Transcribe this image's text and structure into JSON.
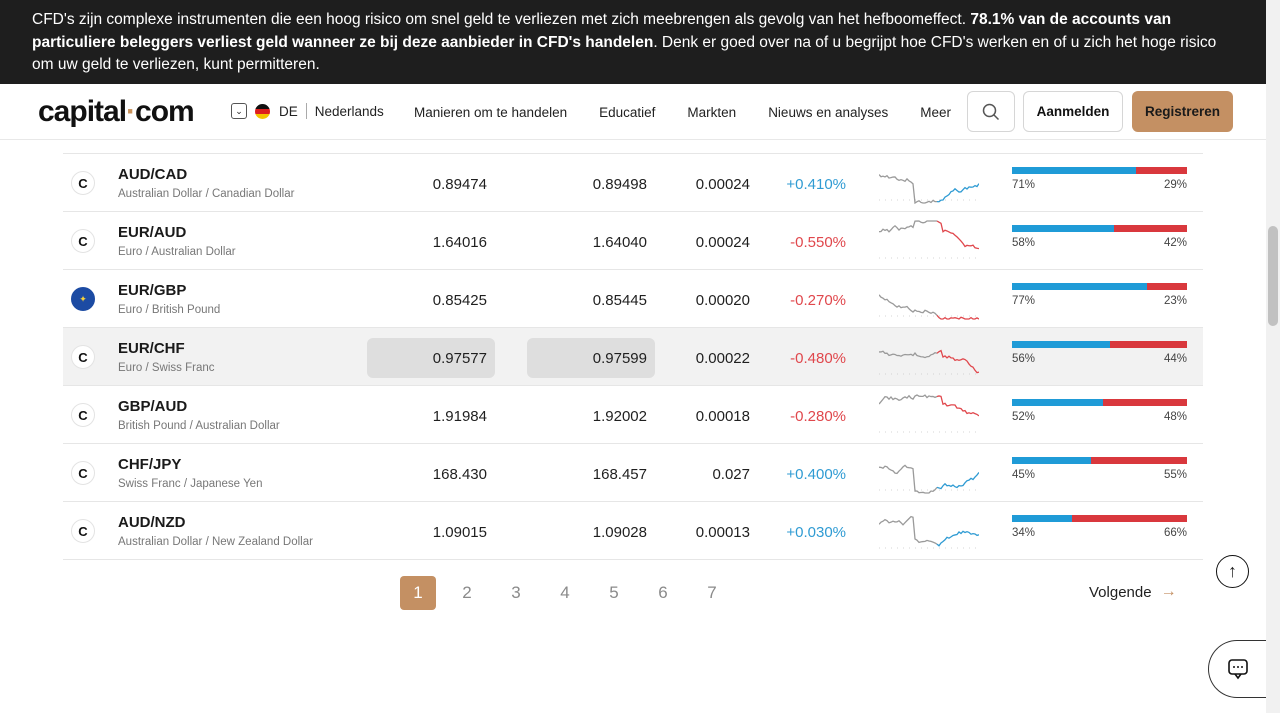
{
  "risk_banner": {
    "text_start": "CFD's zijn complexe instrumenten die een hoog risico om snel geld te verliezen met zich meebrengen als gevolg van het hefboomeffect. ",
    "text_bold": "78.1% van de accounts van particuliere beleggers verliest geld wanneer ze bij deze aanbieder in CFD's handelen",
    "text_end": ". Denk er goed over na of u begrijpt hoe CFD's werken en of u zich het hoge risico om uw geld te verliezen, kunt permitteren."
  },
  "header": {
    "logo_left": "capital",
    "logo_dot": "·",
    "logo_right": "com",
    "country_code": "DE",
    "language": "Nederlands",
    "nav": [
      "Manieren om te handelen",
      "Educatief",
      "Markten",
      "Nieuws en analyses",
      "Meer"
    ],
    "login_label": "Aanmelden",
    "register_label": "Registreren"
  },
  "table": {
    "rows": [
      {
        "symbol": "AUD/CAD",
        "description": "Australian Dollar / Canadian Dollar",
        "icon": "capital-logo",
        "sell": "0.89474",
        "buy": "0.89498",
        "spread": "0.00024",
        "change": "+0.410%",
        "direction": "up",
        "buy_pct": 71,
        "sell_pct": 29,
        "buy_label": "71%",
        "sell_label": "29%",
        "hover": false
      },
      {
        "symbol": "EUR/AUD",
        "description": "Euro / Australian Dollar",
        "icon": "capital-logo",
        "sell": "1.64016",
        "buy": "1.64040",
        "spread": "0.00024",
        "change": "-0.550%",
        "direction": "down",
        "buy_pct": 58,
        "sell_pct": 42,
        "buy_label": "58%",
        "sell_label": "42%",
        "hover": false
      },
      {
        "symbol": "EUR/GBP",
        "description": "Euro / British Pound",
        "icon": "eu-flag",
        "sell": "0.85425",
        "buy": "0.85445",
        "spread": "0.00020",
        "change": "-0.270%",
        "direction": "down",
        "buy_pct": 77,
        "sell_pct": 23,
        "buy_label": "77%",
        "sell_label": "23%",
        "hover": false
      },
      {
        "symbol": "EUR/CHF",
        "description": "Euro / Swiss Franc",
        "icon": "capital-logo",
        "sell": "0.97577",
        "buy": "0.97599",
        "spread": "0.00022",
        "change": "-0.480%",
        "direction": "down",
        "buy_pct": 56,
        "sell_pct": 44,
        "buy_label": "56%",
        "sell_label": "44%",
        "hover": true
      },
      {
        "symbol": "GBP/AUD",
        "description": "British Pound / Australian Dollar",
        "icon": "capital-logo",
        "sell": "1.91984",
        "buy": "1.92002",
        "spread": "0.00018",
        "change": "-0.280%",
        "direction": "down",
        "buy_pct": 52,
        "sell_pct": 48,
        "buy_label": "52%",
        "sell_label": "48%",
        "hover": false
      },
      {
        "symbol": "CHF/JPY",
        "description": "Swiss Franc / Japanese Yen",
        "icon": "capital-logo",
        "sell": "168.430",
        "buy": "168.457",
        "spread": "0.027",
        "change": "+0.400%",
        "direction": "up",
        "buy_pct": 45,
        "sell_pct": 55,
        "buy_label": "45%",
        "sell_label": "55%",
        "hover": false
      },
      {
        "symbol": "AUD/NZD",
        "description": "Australian Dollar / New Zealand Dollar",
        "icon": "capital-logo",
        "sell": "1.09015",
        "buy": "1.09028",
        "spread": "0.00013",
        "change": "+0.030%",
        "direction": "up",
        "buy_pct": 34,
        "sell_pct": 66,
        "buy_label": "34%",
        "sell_label": "66%",
        "hover": false
      }
    ]
  },
  "pagination": {
    "pages": [
      "1",
      "2",
      "3",
      "4",
      "5",
      "6",
      "7"
    ],
    "current": "1",
    "next_label": "Volgende"
  },
  "colors": {
    "accent": "#c49063",
    "positive": "#2f9bd3",
    "negative": "#e0474c",
    "sentiment_buy": "#1f9bd7",
    "sentiment_sell": "#d9383d",
    "banner_bg": "#1e1e1e"
  }
}
